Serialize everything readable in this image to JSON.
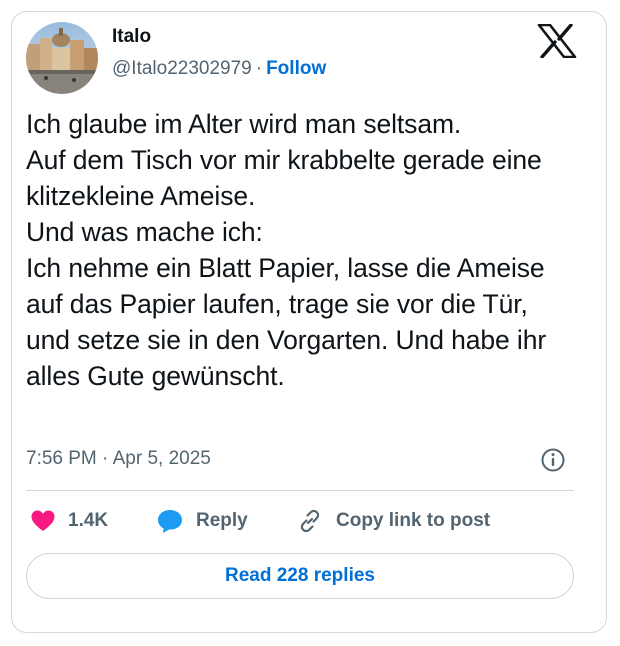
{
  "author": {
    "name": "Italo",
    "handle": "@Italo22302979",
    "separator": "·",
    "follow_label": "Follow",
    "avatar_icon": "profile-photo-town-square"
  },
  "brand_icon": "x-logo-icon",
  "tweet": {
    "text": "Ich glaube im Alter wird man seltsam.\nAuf dem Tisch vor mir krabbelte gerade eine klitzekleine Ameise.\nUnd was mache ich:\nIch nehme ein Blatt Papier, lasse die Ameise auf das Papier laufen, trage sie vor die Tür, und setze sie in den Vorgarten. Und habe ihr alles Gute gewünscht.",
    "timestamp": "7:56 PM · Apr 5, 2025"
  },
  "actions": {
    "like_count": "1.4K",
    "reply_label": "Reply",
    "copy_label": "Copy link to post"
  },
  "read_replies_label": "Read 228 replies",
  "colors": {
    "accent": "#006fd6",
    "heart": "#f91880",
    "reply_bubble": "#1d9bf0",
    "muted_text": "#536471",
    "border": "#cfd9de"
  }
}
